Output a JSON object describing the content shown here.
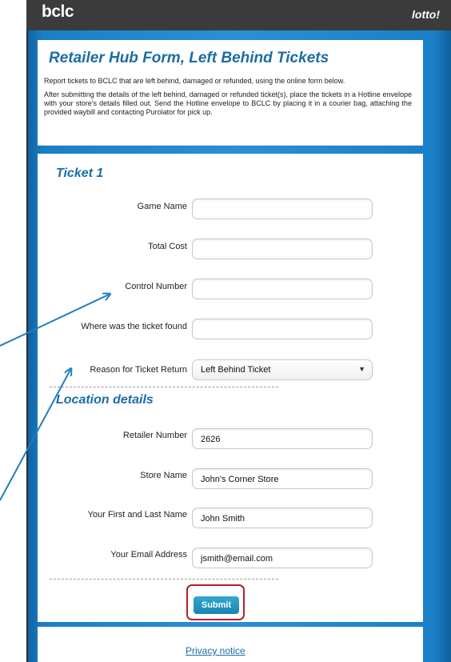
{
  "header": {
    "logo": "bclc",
    "brand_right": "lotto!"
  },
  "page": {
    "title": "Retailer Hub Form, Left Behind Tickets",
    "intro_1": "Report tickets to BCLC that are left behind, damaged or refunded, using the online form below.",
    "intro_2": "After submitting the details of the left behind, damaged or refunded ticket(s), place the tickets in a Hotline envelope with your store's details filled out. Send the Hotline envelope to BCLC by placing it in a courier bag, attaching the provided waybill and contacting Purolator for pick up."
  },
  "ticket_section": {
    "title": "Ticket 1",
    "fields": [
      {
        "label": "Game Name",
        "value": ""
      },
      {
        "label": "Total Cost",
        "value": ""
      },
      {
        "label": "Control Number",
        "value": ""
      },
      {
        "label": "Where was the ticket found",
        "value": ""
      }
    ],
    "reason": {
      "label": "Reason for Ticket Return",
      "selected": "Left Behind Ticket"
    }
  },
  "location_section": {
    "title": "Location details",
    "fields": [
      {
        "label": "Retailer Number",
        "value": "2626"
      },
      {
        "label": "Store Name",
        "value": "John's Corner Store"
      },
      {
        "label": "Your First and Last Name",
        "value": "John Smith"
      },
      {
        "label": "Your Email Address",
        "value": "jsmith@email.com"
      }
    ]
  },
  "actions": {
    "submit_label": "Submit"
  },
  "footer": {
    "privacy_label": "Privacy notice"
  },
  "colors": {
    "accent_blue": "#1c6da5",
    "background_blue": "#2a8fd6",
    "annotation_blue": "#1f7fbf",
    "highlight_red": "#b1202a",
    "topbar": "#3b3b3b"
  }
}
